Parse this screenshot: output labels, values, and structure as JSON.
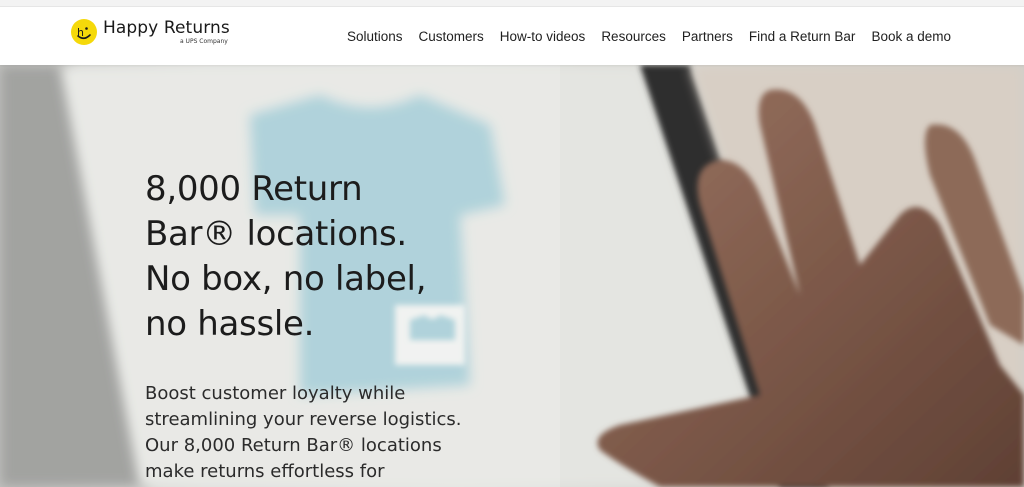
{
  "brand": {
    "name": "Happy Returns",
    "tagline": "a UPS Company",
    "logo_icon": "smiley-logo-icon",
    "accent_color": "#f5d90a"
  },
  "nav": {
    "items": [
      {
        "label": "Solutions"
      },
      {
        "label": "Customers"
      },
      {
        "label": "How-to videos"
      },
      {
        "label": "Resources"
      },
      {
        "label": "Partners"
      },
      {
        "label": "Find a Return Bar"
      },
      {
        "label": "Book a demo"
      }
    ]
  },
  "hero": {
    "headline_lines": [
      "8,000 Return",
      "Bar® locations.",
      "No box, no label,",
      "no hassle."
    ],
    "subcopy_lines": [
      "Boost customer loyalty while",
      "streamlining your reverse logistics.",
      "Our 8,000 Return Bar® locations",
      "make returns effortless for"
    ]
  }
}
